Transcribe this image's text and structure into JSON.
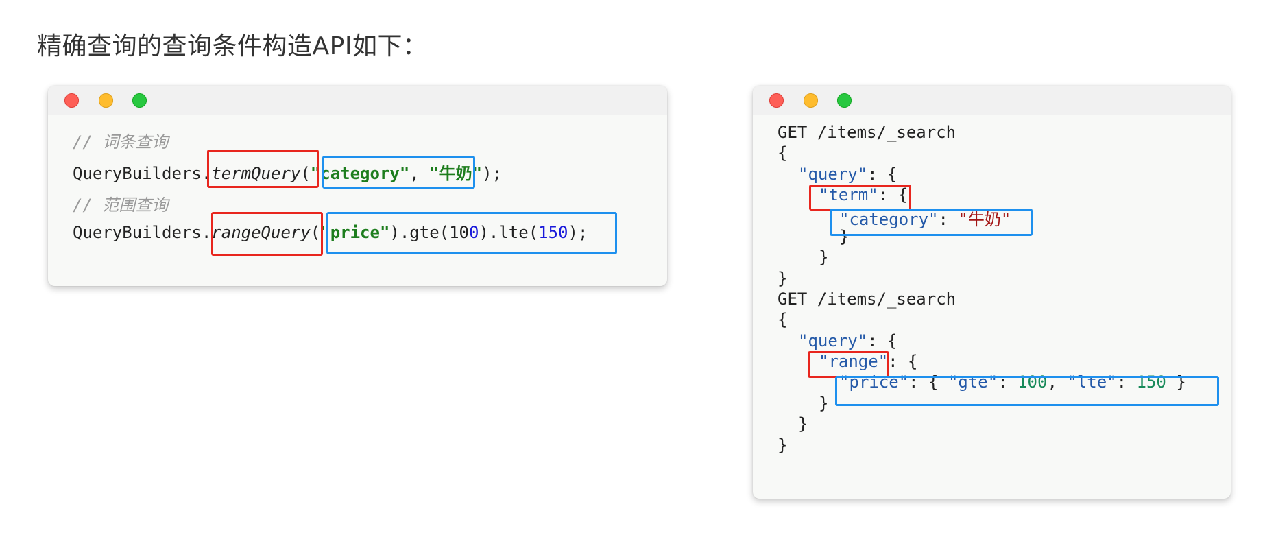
{
  "heading": "精确查询的查询条件构造API如下：",
  "left_window": {
    "lines": {
      "comment1": "// 词条查询",
      "l2_prefix": "QueryBuilders",
      "l2_dot": ".",
      "l2_method": "termQuery",
      "l2_paren": "(",
      "l2_arg1": "\"category\"",
      "l2_sep": ", ",
      "l2_arg2": "\"牛奶\"",
      "l2_end": ");",
      "comment2": "// 范围查询",
      "l4_prefix": "QueryBuilders",
      "l4_dot": ".",
      "l4_method": "rangeQuery",
      "l4_paren": "(",
      "l4_arg": "\"price\"",
      "l4_mid": ").gte(10",
      "l4_zero": "0",
      "l4_mid2": ").lte(",
      "l4_num": "150",
      "l4_end": ");"
    }
  },
  "right_window": {
    "get1": "GET /items/_search",
    "b1_open": "{",
    "q1_key": "\"query\"",
    "q1_rest": ": {",
    "term_key": "\"term\"",
    "term_rest": ": {",
    "cat_key": "\"category\"",
    "cat_colon": ": ",
    "cat_val": "\"牛奶\"",
    "close_a": "}",
    "close_b": "}",
    "close_c": "}",
    "get2": "GET /items/_search",
    "b2_open": "{",
    "q2_key": "\"query\"",
    "q2_rest": ": {",
    "range_key": "\"range\"",
    "range_rest": ": {",
    "price_key": "\"price\"",
    "price_open": ": { ",
    "gte_key": "\"gte\"",
    "gte_colon": ": ",
    "gte_val": "100",
    "comma": ", ",
    "lte_key": "\"lte\"",
    "lte_colon": ": ",
    "lte_val": "150",
    "price_close": " }",
    "close_d": "}",
    "close_e": "}",
    "close_f": "}"
  }
}
